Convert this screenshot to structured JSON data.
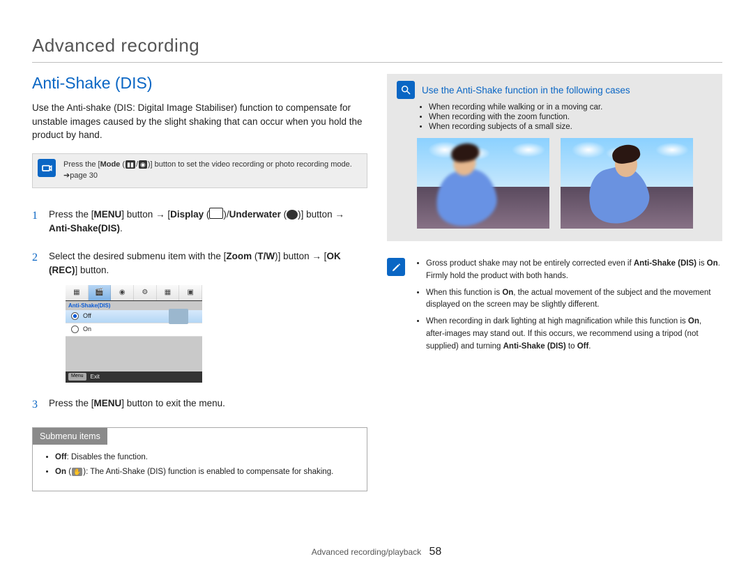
{
  "chapter": "Advanced recording",
  "section_title": "Anti-Shake (DIS)",
  "lead_text": "Use the Anti-shake (DIS: Digital Image Stabiliser) function to compensate for unstable images caused by the slight shaking that can occur when you hold the product by hand.",
  "mode_note": {
    "pre": "Press the [",
    "b1": "Mode",
    "mid1": " (",
    "i1_label": "video-mode",
    "sep": "/",
    "i2_label": "photo-mode",
    "mid2": ")] button to set the video recording or photo recording mode. ",
    "page_ref": "➔page 30"
  },
  "steps": [
    {
      "num": "1",
      "parts": {
        "a": "Press the [",
        "menu": "MENU",
        "b": "] button → [",
        "display": "Display",
        "c": " (",
        "d": ")/",
        "underwater": "Underwater",
        "e": " (",
        "f": ")] button → ",
        "target": "Anti-Shake(DIS)",
        "g": "."
      }
    },
    {
      "num": "2",
      "parts": {
        "a": "Select the desired submenu item with the [",
        "zoom": "Zoom",
        "b": " (",
        "tw": "T/W",
        "c": ")] button → [",
        "ok": "OK (REC)",
        "d": "] button."
      }
    },
    {
      "num": "3",
      "parts": {
        "a": "Press the [",
        "menu": "MENU",
        "b": "] button to exit the menu."
      }
    }
  ],
  "osd": {
    "tabs_count": 6,
    "title": "Anti-Shake(DIS)",
    "items": [
      "Off",
      "On"
    ],
    "selected_index": 0,
    "footer_btn": "Menu",
    "footer_label": "Exit"
  },
  "submenu": {
    "heading": "Submenu items",
    "items": [
      {
        "prefix": "Off",
        "text": ": Disables the function."
      },
      {
        "prefix": "On",
        "icon": true,
        "text": "): The Anti-Shake (DIS) function is enabled to compensate for shaking."
      }
    ]
  },
  "tip": {
    "title": "Use the Anti-Shake function in the following cases",
    "bullets": [
      "When recording while walking or in a moving car.",
      "When recording with the zoom function.",
      "When recording subjects of a small size."
    ]
  },
  "warn": {
    "items": [
      {
        "text_a": "Gross product shake may not be entirely corrected even if ",
        "b1": "Anti-Shake (DIS)",
        "text_b": " is ",
        "b2": "On",
        "text_c": ". Firmly hold the product with both hands."
      },
      {
        "text_a": "When this function is ",
        "b1": "On",
        "text_b": ", the actual movement of the subject and the movement displayed on the screen may be slightly different.",
        "b2": "",
        "text_c": ""
      },
      {
        "text_a": "When recording in dark lighting at high magnification while this function is ",
        "b1": "On",
        "text_b": ", after-images may stand out. If this occurs, we recommend using a tripod (not supplied) and turning ",
        "b2": "Anti-Shake (DIS)",
        "text_c": " to ",
        "b3": "Off",
        "text_d": "."
      }
    ]
  },
  "footer": {
    "text": "Advanced recording/playback",
    "page": "58"
  }
}
